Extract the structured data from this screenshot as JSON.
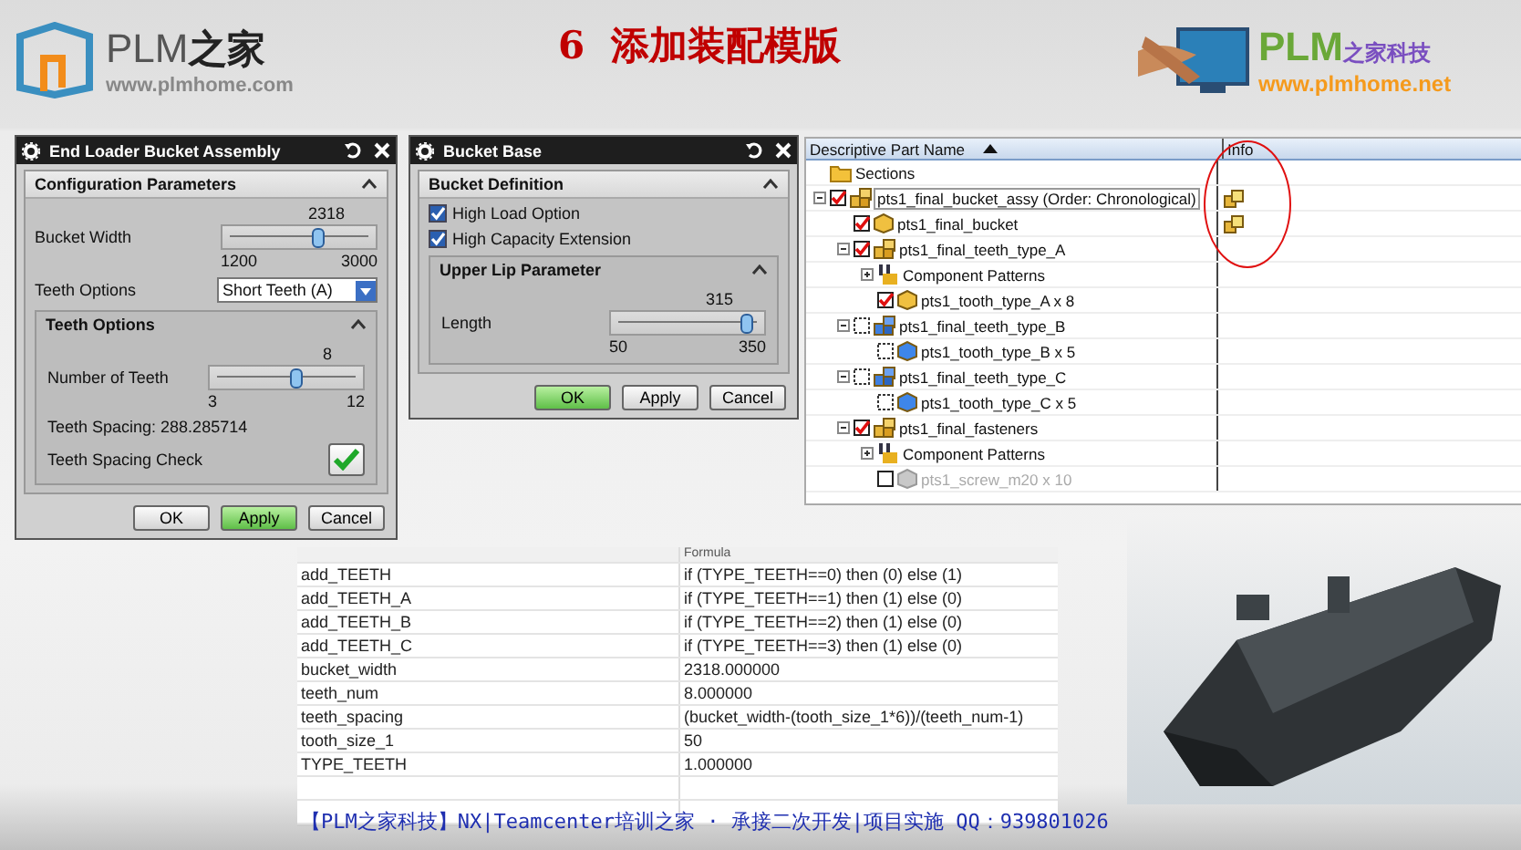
{
  "header": {
    "logo_left": {
      "brand": "PLM",
      "brand_cn": "之家",
      "url": "www.plmhome.com"
    },
    "title": "6  添加装配模版",
    "logo_right": {
      "brand": "PLM",
      "brand_cn": "之家科技",
      "url": "www.plmhome.net"
    }
  },
  "dialogs": [
    {
      "title": "End Loader Bucket Assembly",
      "sections": [
        {
          "title": "Configuration Parameters",
          "rows": [
            {
              "kind": "slider",
              "label": "Bucket Width",
              "value": "2318",
              "min": "1200",
              "max": "3000",
              "level": 0.62
            },
            {
              "kind": "dropdown",
              "label": "Teeth Options",
              "value": "Short Teeth (A)"
            },
            {
              "kind": "group",
              "title": "Teeth Options",
              "rows": [
                {
                  "kind": "slider",
                  "label": "Number of Teeth",
                  "value": "8",
                  "min": "3",
                  "max": "12",
                  "level": 0.56
                },
                {
                  "kind": "text",
                  "label": "Teeth Spacing: 288.285714"
                },
                {
                  "kind": "check_button",
                  "label": "Teeth Spacing Check"
                }
              ]
            }
          ]
        }
      ],
      "buttons": [
        {
          "label": "OK",
          "default": false
        },
        {
          "label": "Apply",
          "default": true
        },
        {
          "label": "Cancel",
          "default": false
        }
      ]
    },
    {
      "title": "Bucket Base",
      "sections": [
        {
          "title": "Bucket Definition",
          "rows": [
            {
              "kind": "checkbox",
              "label": "High Load Option",
              "checked": true
            },
            {
              "kind": "checkbox",
              "label": "High Capacity Extension",
              "checked": true
            },
            {
              "kind": "group",
              "title": "Upper Lip Parameter",
              "rows": [
                {
                  "kind": "slider",
                  "label": "Length",
                  "value": "315",
                  "min": "50",
                  "max": "350",
                  "level": 0.88
                }
              ]
            }
          ]
        }
      ],
      "buttons": [
        {
          "label": "OK",
          "default": true
        },
        {
          "label": "Apply",
          "default": false
        },
        {
          "label": "Cancel",
          "default": false
        }
      ]
    }
  ],
  "tree": {
    "columns": [
      {
        "label": "Descriptive Part Name",
        "sorted": true
      },
      {
        "label": "Info",
        "sorted": false
      }
    ],
    "nodes": [
      {
        "kind": "folder",
        "label": "Sections"
      },
      {
        "kind": "assembly",
        "label": "pts1_final_bucket_assy (Order: Chronological)",
        "checked": true,
        "suppressed": false,
        "disabled": false,
        "selected": true,
        "info": true,
        "expanded": true,
        "children": [
          {
            "kind": "part",
            "label": "pts1_final_bucket",
            "checked": true,
            "suppressed": false,
            "disabled": false,
            "selected": false,
            "info": true
          },
          {
            "kind": "assembly",
            "label": "pts1_final_teeth_type_A",
            "checked": true,
            "suppressed": false,
            "disabled": false,
            "selected": false,
            "info": false,
            "expanded": true,
            "children": [
              {
                "kind": "pattern",
                "label": "Component Patterns",
                "expanded": false
              },
              {
                "kind": "part",
                "label": "pts1_tooth_type_A x 8",
                "checked": true,
                "suppressed": false,
                "disabled": false,
                "selected": false,
                "info": false
              }
            ]
          },
          {
            "kind": "assembly",
            "label": "pts1_final_teeth_type_B",
            "checked": false,
            "suppressed": true,
            "disabled": false,
            "selected": false,
            "info": false,
            "expanded": true,
            "children": [
              {
                "kind": "part",
                "label": "pts1_tooth_type_B x 5",
                "checked": false,
                "suppressed": true,
                "disabled": false,
                "selected": false,
                "info": false
              }
            ]
          },
          {
            "kind": "assembly",
            "label": "pts1_final_teeth_type_C",
            "checked": false,
            "suppressed": true,
            "disabled": false,
            "selected": false,
            "info": false,
            "expanded": true,
            "children": [
              {
                "kind": "part",
                "label": "pts1_tooth_type_C x 5",
                "checked": false,
                "suppressed": true,
                "disabled": false,
                "selected": false,
                "info": false
              }
            ]
          },
          {
            "kind": "assembly",
            "label": "pts1_final_fasteners",
            "checked": true,
            "suppressed": false,
            "disabled": false,
            "selected": false,
            "info": false,
            "expanded": true,
            "children": [
              {
                "kind": "pattern",
                "label": "Component Patterns",
                "expanded": false
              },
              {
                "kind": "part",
                "label": "pts1_screw_m20 x 10",
                "checked": false,
                "suppressed": false,
                "disabled": true,
                "selected": false,
                "info": false
              }
            ]
          }
        ]
      }
    ]
  },
  "formula_table": {
    "formula_header": "Formula",
    "rows": [
      {
        "column_1": "add_TEETH",
        "formula": "if (TYPE_TEETH==0) then (0) else (1)"
      },
      {
        "column_1": "add_TEETH_A",
        "formula": "if (TYPE_TEETH==1) then (1) else (0)"
      },
      {
        "column_1": "add_TEETH_B",
        "formula": "if (TYPE_TEETH==2) then (1) else (0)"
      },
      {
        "column_1": "add_TEETH_C",
        "formula": "if (TYPE_TEETH==3) then (1) else (0)"
      },
      {
        "column_1": "bucket_width",
        "formula": "2318.000000"
      },
      {
        "column_1": "teeth_num",
        "formula": "8.000000"
      },
      {
        "column_1": "teeth_spacing",
        "formula": "(bucket_width-(tooth_size_1*6))/(teeth_num-1)"
      },
      {
        "column_1": "tooth_size_1",
        "formula": "50"
      },
      {
        "column_1": "TYPE_TEETH",
        "formula": "1.000000"
      }
    ]
  },
  "footer": "【PLM之家科技】NX|Teamcenter培训之家 · 承接二次开发|项目实施 QQ：939801026"
}
